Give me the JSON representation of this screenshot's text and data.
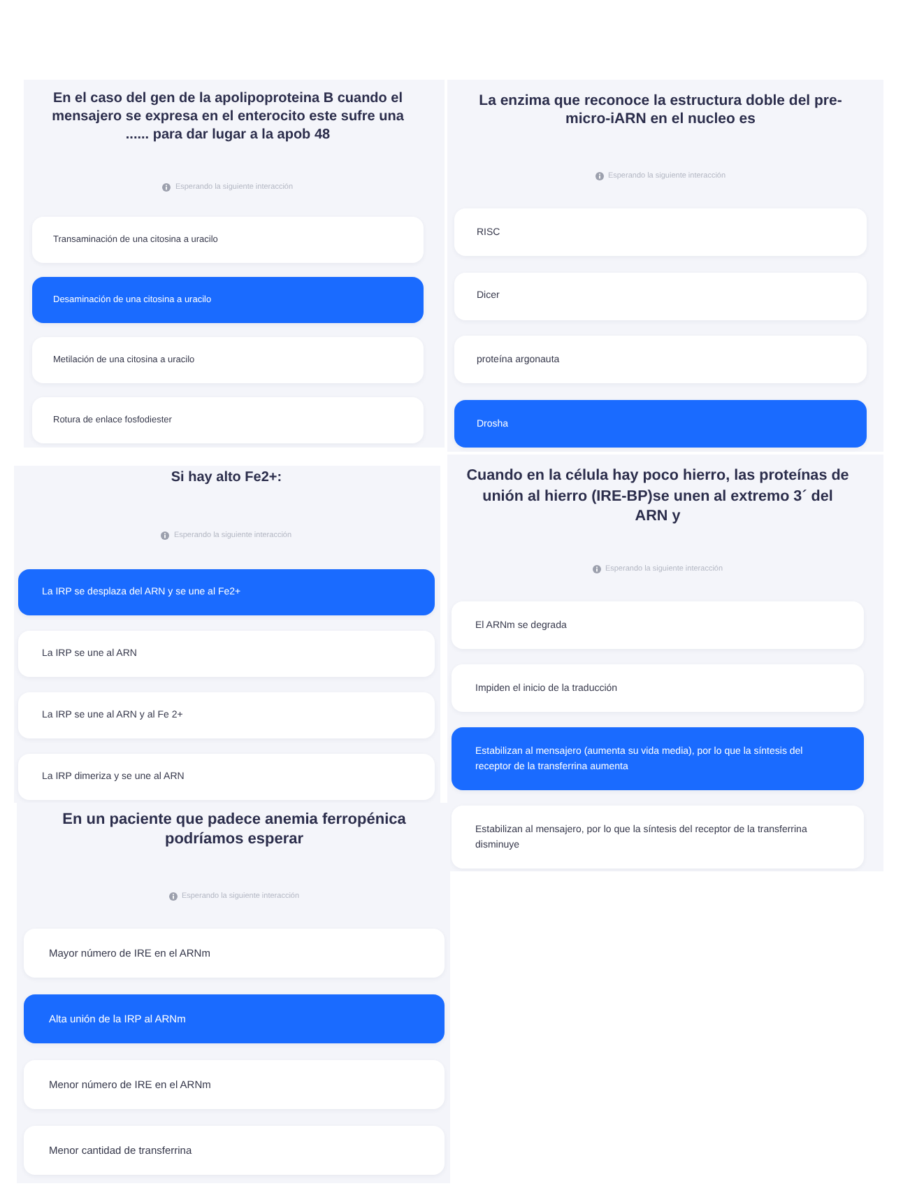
{
  "questions": [
    {
      "title": "En el caso del gen de la apolipoproteina B cuando el mensajero se expresa en el enterocito este sufre una ...... para dar lugar a la apob 48",
      "status": "Esperando la siguiente interacción",
      "options": [
        {
          "label": "Transaminación de una citosina a uracilo",
          "selected": false
        },
        {
          "label": "Desaminación de una citosina a uracilo",
          "selected": true
        },
        {
          "label": "Metilación de una citosina a uracilo",
          "selected": false
        },
        {
          "label": "Rotura de enlace fosfodiester",
          "selected": false
        }
      ]
    },
    {
      "title": "La enzima que reconoce la estructura doble del pre-micro-iARN en el nucleo es",
      "status": "Esperando la siguiente interacción",
      "options": [
        {
          "label": "RISC",
          "selected": false
        },
        {
          "label": "Dicer",
          "selected": false
        },
        {
          "label": "proteína argonauta",
          "selected": false
        },
        {
          "label": "Drosha",
          "selected": true
        }
      ]
    },
    {
      "title": "Si hay alto Fe2+:",
      "status": "Esperando la siguiente interacción",
      "options": [
        {
          "label": "La IRP se desplaza del ARN y se une al Fe2+",
          "selected": true
        },
        {
          "label": "La IRP se une al ARN",
          "selected": false
        },
        {
          "label": "La IRP se une al ARN y al Fe 2+",
          "selected": false
        },
        {
          "label": "La IRP dimeriza y se une al ARN",
          "selected": false
        }
      ]
    },
    {
      "title": "Cuando en la célula hay poco hierro, las proteínas de unión al hierro (IRE-BP)se unen al extremo 3´ del ARN y",
      "status": "Esperando la siguiente interacción",
      "options": [
        {
          "label": "El ARNm se degrada",
          "selected": false
        },
        {
          "label": "Impiden el inicio de la traducción",
          "selected": false
        },
        {
          "label": "Estabilizan al mensajero (aumenta su vida media), por lo que la síntesis del receptor de la transferrina aumenta",
          "selected": true
        },
        {
          "label": "Estabilizan al mensajero, por lo que la síntesis del receptor de la transferrina disminuye",
          "selected": false
        }
      ]
    },
    {
      "title": "En un paciente que padece anemia ferropénica podríamos esperar",
      "status": "Esperando la siguiente interacción",
      "options": [
        {
          "label": "Mayor número de IRE en el ARNm",
          "selected": false
        },
        {
          "label": "Alta unión de la IRP al ARNm",
          "selected": true
        },
        {
          "label": "Menor número de IRE en el ARNm",
          "selected": false
        },
        {
          "label": "Menor cantidad de transferrina",
          "selected": false
        }
      ]
    }
  ]
}
